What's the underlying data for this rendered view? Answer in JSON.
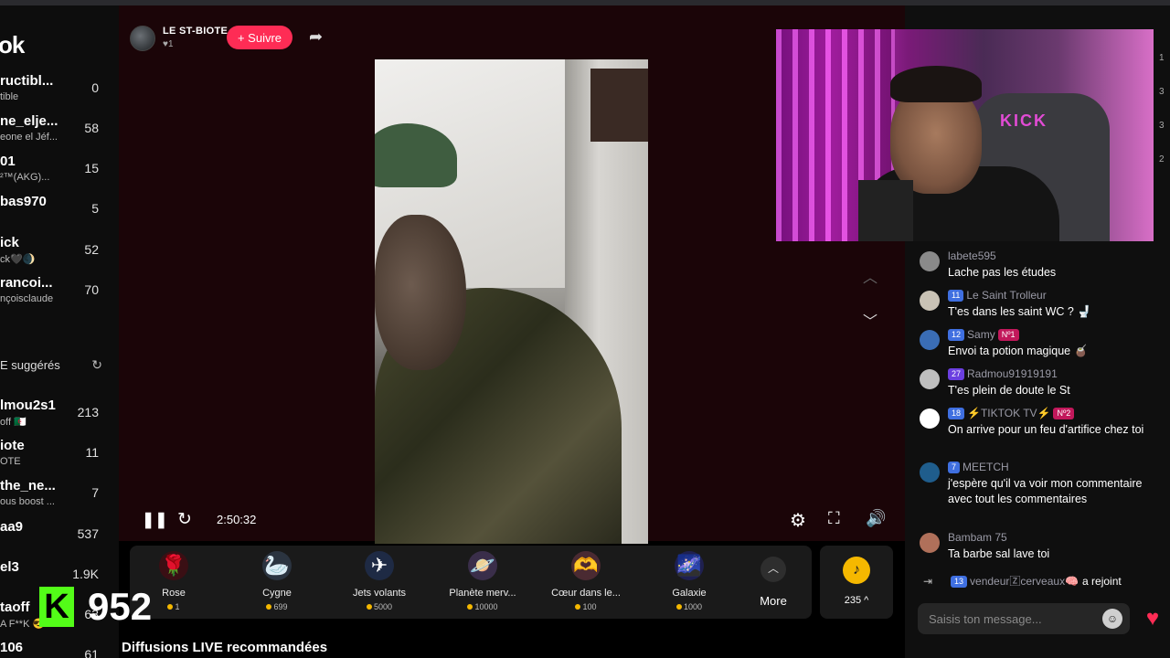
{
  "sidebar": {
    "logo": "ok",
    "accounts": [
      {
        "name": "ructibl...",
        "sub": "tible",
        "count": "0"
      },
      {
        "name": "ne_elje...",
        "sub": "eone el Jéf...",
        "count": "58"
      },
      {
        "name": "01",
        "sub": "²™(AKG)...",
        "count": "15"
      },
      {
        "name": "bas970",
        "sub": "",
        "count": "5"
      },
      {
        "name": "ick",
        "sub": "ck🖤🌒",
        "count": "52"
      },
      {
        "name": "rancoi...",
        "sub": "nçoisclaude",
        "count": "70"
      }
    ],
    "suggested_label": "E suggérés",
    "suggested": [
      {
        "name": "lmou2s1",
        "sub": "off 🇩🇿",
        "count": "213"
      },
      {
        "name": "iote",
        "sub": "OTE",
        "count": "11"
      },
      {
        "name": "the_ne...",
        "sub": "ous boost ...",
        "count": "7"
      },
      {
        "name": "aa9",
        "sub": "",
        "count": "537"
      },
      {
        "name": "el3",
        "sub": "",
        "count": "1.9K"
      },
      {
        "name": "taoff",
        "sub": "A F**K 😎",
        "count": "63"
      },
      {
        "name": "106",
        "sub": "",
        "count": "61"
      }
    ]
  },
  "creator": {
    "name": "LE ST-BIOTE",
    "likes": "♥1",
    "follow_label": "+ Suivre"
  },
  "player": {
    "time": "2:50:32",
    "icons": [
      "pause-icon",
      "refresh-icon",
      "settings-icon",
      "fullscreen-icon",
      "volume-icon",
      "share-icon",
      "chevron-up-icon",
      "chevron-down-icon"
    ]
  },
  "gifts": [
    {
      "name": "Rose",
      "price": "1",
      "icon": "🌹"
    },
    {
      "name": "Cygne",
      "price": "699",
      "icon": "🦢"
    },
    {
      "name": "Jets volants",
      "price": "5000",
      "icon": "✈"
    },
    {
      "name": "Planète merv...",
      "price": "10000",
      "icon": "🪐"
    },
    {
      "name": "Cœur dans le...",
      "price": "100",
      "icon": "🫶"
    },
    {
      "name": "Galaxie",
      "price": "1000",
      "icon": "🌌"
    }
  ],
  "more_label": "More",
  "coins_value": "235 ^",
  "recommended_title": "Diffusions LIVE recommandées",
  "kick": {
    "badge": "K",
    "count": "952"
  },
  "webcam": {
    "brand": "KICK"
  },
  "chat": {
    "messages": [
      {
        "user": "labete595",
        "level": "",
        "rank": "",
        "text": "Lache pas les études",
        "avatar_color": "#8a8a8a"
      },
      {
        "user": "Le Saint Trolleur",
        "level": "11",
        "rank": "",
        "text": "T'es dans les saint WC ? 🚽",
        "avatar_color": "#c9c2b5"
      },
      {
        "user": "Samy",
        "level": "12",
        "rank": "Nº1",
        "text": "Envoi ta potion magique 🧉",
        "avatar_color": "#3a6db5"
      },
      {
        "user": "Radmou91919191",
        "level": "27",
        "rank": "",
        "text": "T'es plein de doute le St",
        "avatar_color": "#bfbfbf",
        "purple": true
      },
      {
        "user": "⚡TIKTOK TV⚡",
        "level": "18",
        "rank": "Nº2",
        "text": "On arrive pour un feu d'artifice chez toi",
        "avatar_color": "#ffffff"
      },
      {
        "user": "MEETCH",
        "level": "7",
        "rank": "",
        "text": "j'espère qu'il va voir mon commentaire avec tout les commentaires",
        "avatar_color": "#1f5d8c"
      },
      {
        "user": "Bambam 75",
        "level": "",
        "rank": "",
        "text": "Ta barbe sal lave toi",
        "avatar_color": "#b0705a"
      }
    ],
    "join": {
      "level": "13",
      "user": "vendeur🅉cerveaux🧠",
      "text": "a rejoint"
    },
    "input_placeholder": "Saisis ton message...",
    "scroll_numbers": [
      "1",
      "3",
      "3",
      "2"
    ]
  },
  "colors": {
    "accent": "#fe2c55",
    "kick_green": "#53fc18",
    "level_blue": "#3f6fe0",
    "rank_pink": "#c2185b"
  }
}
